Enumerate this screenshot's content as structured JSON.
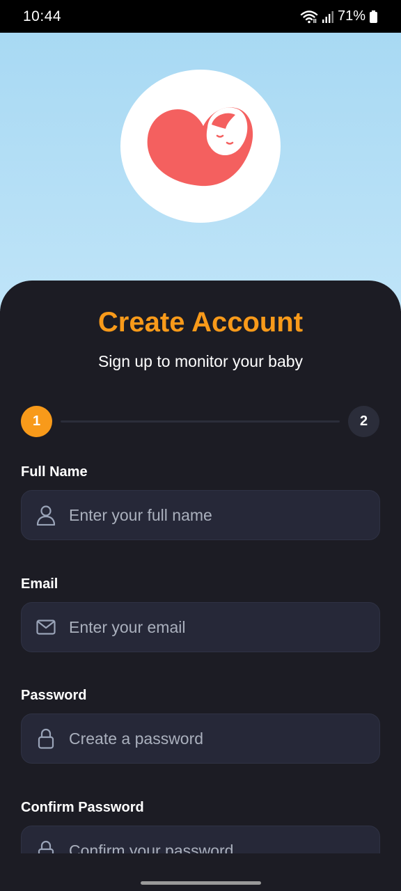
{
  "status_bar": {
    "time": "10:44",
    "battery": "71%",
    "icons": [
      "wifi-icon",
      "signal-icon",
      "battery-icon"
    ]
  },
  "hero": {
    "logo_icon": "heart-baby-icon",
    "logo_color": "#f4605f",
    "background": "#a8d9f3"
  },
  "form": {
    "title": "Create Account",
    "subtitle": "Sign up to monitor your baby",
    "accent_color": "#f89a1a",
    "steps": [
      {
        "number": "1",
        "active": true
      },
      {
        "number": "2",
        "active": false
      }
    ],
    "fields": [
      {
        "label": "Full Name",
        "placeholder": "Enter your full name",
        "value": "",
        "icon": "user-icon"
      },
      {
        "label": "Email",
        "placeholder": "Enter your email",
        "value": "",
        "icon": "mail-icon"
      },
      {
        "label": "Password",
        "placeholder": "Create a password",
        "value": "",
        "icon": "lock-icon"
      },
      {
        "label": "Confirm Password",
        "placeholder": "Confirm your password",
        "value": "",
        "icon": "lock-icon"
      }
    ]
  }
}
